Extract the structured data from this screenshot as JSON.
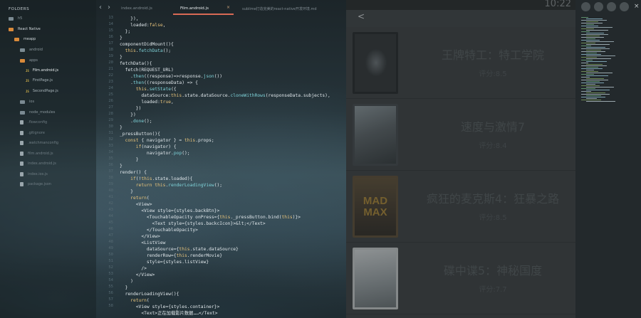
{
  "sidebar": {
    "header": "FOLDERS",
    "items": [
      {
        "label": "h5",
        "kind": "folder"
      },
      {
        "label": "React Native",
        "kind": "folder-open"
      },
      {
        "label": "meapp",
        "kind": "folder-open"
      },
      {
        "label": "android",
        "kind": "folder"
      },
      {
        "label": "apps",
        "kind": "folder-open"
      },
      {
        "label": "Film.android.js",
        "kind": "js"
      },
      {
        "label": "FirstPage.js",
        "kind": "js"
      },
      {
        "label": "SecondPage.js",
        "kind": "js"
      },
      {
        "label": "ios",
        "kind": "folder"
      },
      {
        "label": "node_modules",
        "kind": "folder"
      },
      {
        "label": ".flowconfig",
        "kind": "file"
      },
      {
        "label": ".gitignore",
        "kind": "file"
      },
      {
        "label": ".watchmanconfig",
        "kind": "file"
      },
      {
        "label": "film.android.js",
        "kind": "file"
      },
      {
        "label": "index.android.js",
        "kind": "file"
      },
      {
        "label": "index.ios.js",
        "kind": "file"
      },
      {
        "label": "package.json",
        "kind": "file"
      }
    ]
  },
  "tabs": [
    {
      "label": "index.android.js",
      "active": false
    },
    {
      "label": "Film.android.js",
      "active": true
    },
    {
      "label": "sublime打造完美的react-native开发环境.md",
      "active": false
    }
  ],
  "editor": {
    "line_numbers": [
      "13",
      "14",
      "15",
      "16",
      "17",
      "18",
      "19",
      "20",
      "21",
      "22",
      "23",
      "24",
      "25",
      "26",
      "27",
      "28",
      "29",
      "30",
      "31",
      "32",
      "33",
      "34",
      "35",
      "36",
      "37",
      "38",
      "39",
      "40",
      "41",
      "42",
      "43",
      "44",
      "45",
      "46",
      "47",
      "48",
      "49",
      "50",
      "51",
      "52",
      "53",
      "54",
      "55",
      "56",
      "57",
      "58"
    ],
    "code": [
      "    }),",
      "    loaded:false,",
      "  };",
      "}",
      "componentDidMount(){",
      "  this.fetchData();",
      "}",
      "fetchData(){",
      "  fetch(REQUEST_URL)",
      "    .then((response)=>response.json())",
      "    .then((responseData) => {",
      "      this.setState({",
      "        dataSource:this.state.dataSource.cloneWithRows(responseData.subjects),",
      "        loaded:true,",
      "      })",
      "    })",
      "    .done();",
      "}",
      "_pressButton(){",
      "  const { navigator } = this.props;",
      "      if(navigator) {",
      "          navigator.pop();",
      "      }",
      "}",
      "render() {",
      "    if(!this.state.loaded){",
      "      return this.renderLoadingView();",
      "    }",
      "    return(",
      "      <View>",
      "        <View style={styles.backBtn}>",
      "          <TouchableOpacity onPress={this._pressButton.bind(this)}>",
      "            <Text style={styles.backcIcon}>&lt;</Text>",
      "          </TouchableOpacity>",
      "        </View>",
      "        <ListView",
      "          dataSource={this.state.dataSource}",
      "          renderRow={this.renderMovie}",
      "          style={styles.listView}",
      "        />",
      "      </View>",
      "    )",
      "  }",
      "  renderLoadingView(){",
      "    return(",
      "      <View style={styles.container}>",
      "        <Text>正在加载影片数据……</Text>"
    ]
  },
  "phone": {
    "time": "10:22",
    "back_label": "<",
    "movies": [
      {
        "title": "王牌特工：特工学院",
        "rating": "评分:8.5"
      },
      {
        "title": "速度与激情7",
        "rating": "评分:8.4"
      },
      {
        "title": "疯狂的麦克斯4：狂暴之路",
        "rating": "评分:8.5"
      },
      {
        "title": "碟中谍5：神秘国度",
        "rating": "评分:7.7"
      }
    ],
    "poster_text": {
      "mad_max": "MAD\nMAX"
    }
  },
  "colors": {
    "accent_tab": "#d96a55",
    "folder_open": "#d98a3a",
    "keyword": "#e6c27a",
    "function": "#7fd3d9"
  }
}
